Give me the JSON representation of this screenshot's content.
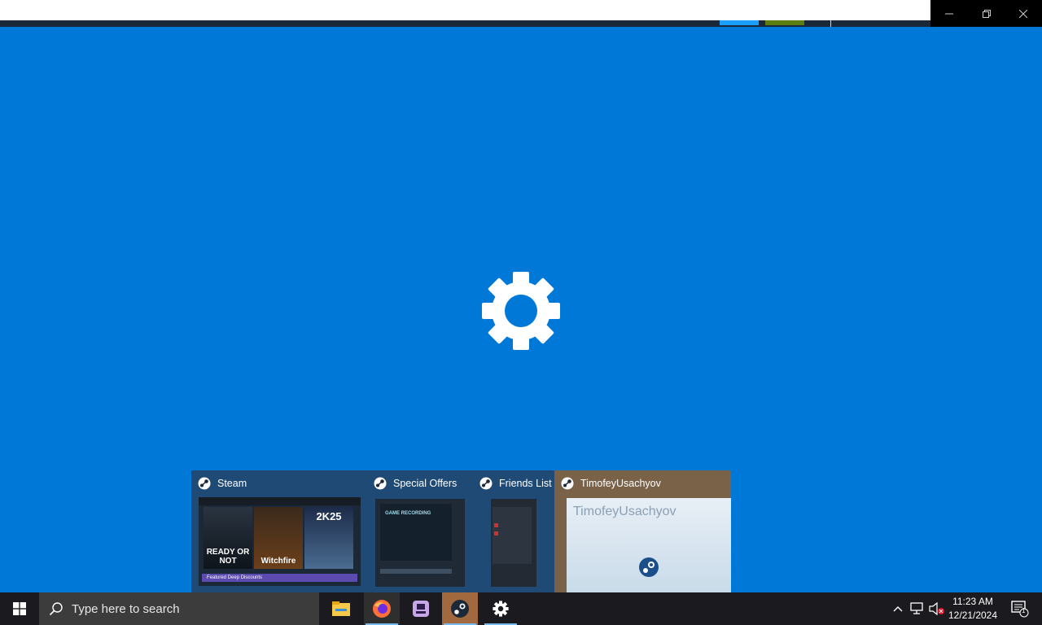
{
  "window": {
    "controls": [
      "minimize",
      "restore",
      "close"
    ]
  },
  "splash": {
    "icon": "settings-gear-icon"
  },
  "thumbnails": [
    {
      "title": "Steam",
      "icon": "steam-icon"
    },
    {
      "title": "Special Offers",
      "icon": "steam-icon",
      "thumb_text": "GAME RECORDING"
    },
    {
      "title": "Friends List",
      "icon": "steam-icon"
    },
    {
      "title": "TimofeyUsachyov",
      "icon": "steam-icon",
      "thumb_text": "TimofeyUsachyov"
    }
  ],
  "steam_thumb": {
    "games": [
      "READY OR NOT",
      "Witchfire",
      "2K25"
    ],
    "banner": "Featured Deep Discounts"
  },
  "taskbar": {
    "search_placeholder": "Type here to search",
    "apps": [
      "file-explorer-icon",
      "firefox-icon",
      "media-app-icon",
      "steam-icon",
      "settings-icon"
    ],
    "clock": {
      "time": "11:23 AM",
      "date": "12/21/2024"
    },
    "notification_count": "1"
  },
  "colors": {
    "desktop_blue": "#0078d7",
    "taskbar": "#1b1b1f",
    "active_app": "#a2693f"
  }
}
